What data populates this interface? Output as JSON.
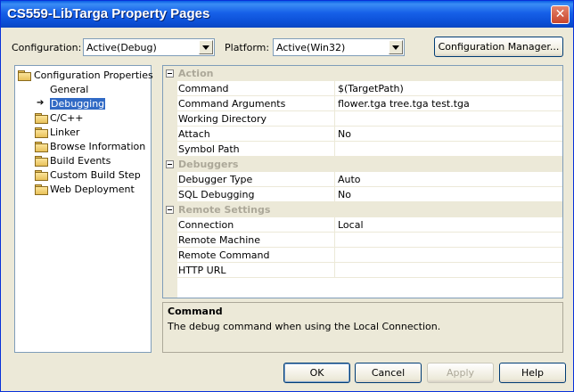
{
  "window": {
    "title": "CS559-LibTarga Property Pages",
    "close_glyph": "✕"
  },
  "top": {
    "configuration_label": "Configuration:",
    "configuration_value": "Active(Debug)",
    "platform_label": "Platform:",
    "platform_value": "Active(Win32)",
    "config_manager_label": "Configuration Manager..."
  },
  "tree": {
    "root": "Configuration Properties",
    "items": [
      {
        "label": "General"
      },
      {
        "label": "Debugging"
      },
      {
        "label": "C/C++"
      },
      {
        "label": "Linker"
      },
      {
        "label": "Browse Information"
      },
      {
        "label": "Build Events"
      },
      {
        "label": "Custom Build Step"
      },
      {
        "label": "Web Deployment"
      }
    ]
  },
  "grid": {
    "categories": [
      {
        "name": "Action"
      },
      {
        "name": "Debuggers"
      },
      {
        "name": "Remote Settings"
      }
    ],
    "action": [
      {
        "name": "Command",
        "value": "$(TargetPath)"
      },
      {
        "name": "Command Arguments",
        "value": "flower.tga tree.tga test.tga"
      },
      {
        "name": "Working Directory",
        "value": ""
      },
      {
        "name": "Attach",
        "value": "No"
      },
      {
        "name": "Symbol Path",
        "value": ""
      }
    ],
    "debuggers": [
      {
        "name": "Debugger Type",
        "value": "Auto"
      },
      {
        "name": "SQL Debugging",
        "value": "No"
      }
    ],
    "remote": [
      {
        "name": "Connection",
        "value": "Local"
      },
      {
        "name": "Remote Machine",
        "value": ""
      },
      {
        "name": "Remote Command",
        "value": ""
      },
      {
        "name": "HTTP URL",
        "value": ""
      }
    ]
  },
  "description": {
    "title": "Command",
    "text": "The debug command when using the Local Connection."
  },
  "buttons": {
    "ok": "OK",
    "cancel": "Cancel",
    "apply": "Apply",
    "help": "Help"
  }
}
